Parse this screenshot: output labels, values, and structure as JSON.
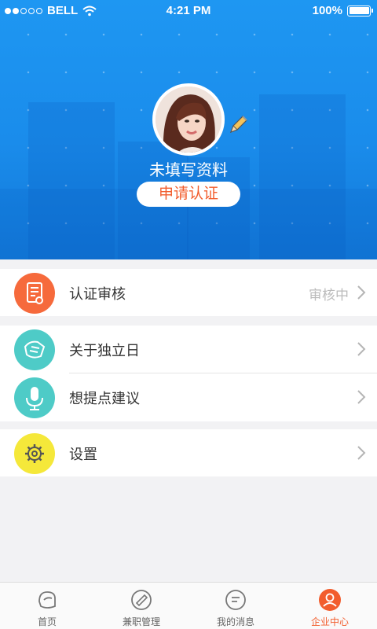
{
  "status_bar": {
    "carrier": "BELL",
    "time": "4:21 PM",
    "battery": "100%"
  },
  "profile": {
    "name": "未填写资料",
    "apply_button": "申请认证"
  },
  "menu": {
    "certification": {
      "label": "认证审核",
      "status": "审核中",
      "icon": "certificate-icon",
      "color": "#f66a3c"
    },
    "about": {
      "label": "关于独立日",
      "icon": "handshake-icon",
      "color": "#4ecbc7"
    },
    "feedback": {
      "label": "想提点建议",
      "icon": "microphone-icon",
      "color": "#4ecbc7"
    },
    "settings": {
      "label": "设置",
      "icon": "gear-icon",
      "color": "#f5e83a"
    }
  },
  "tabs": [
    {
      "label": "首页",
      "icon": "home-icon",
      "active": false
    },
    {
      "label": "兼职管理",
      "icon": "job-icon",
      "active": false
    },
    {
      "label": "我的消息",
      "icon": "message-icon",
      "active": false
    },
    {
      "label": "企业中心",
      "icon": "profile-icon",
      "active": true
    }
  ],
  "colors": {
    "primary_blue": "#1a8ceb",
    "accent_orange": "#f25d2d"
  }
}
